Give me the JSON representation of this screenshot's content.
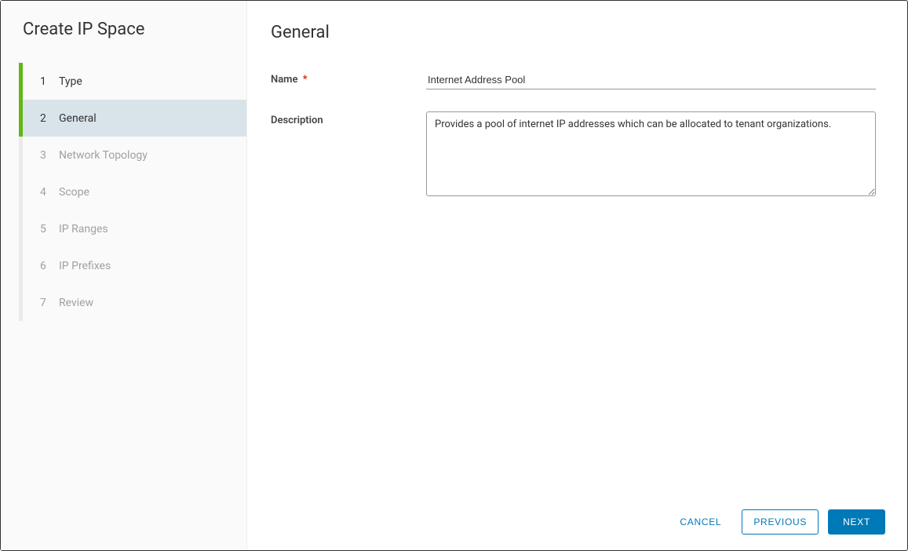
{
  "sidebar": {
    "title": "Create IP Space",
    "steps": [
      {
        "num": "1",
        "label": "Type",
        "state": "completed"
      },
      {
        "num": "2",
        "label": "General",
        "state": "active"
      },
      {
        "num": "3",
        "label": "Network Topology",
        "state": "pending"
      },
      {
        "num": "4",
        "label": "Scope",
        "state": "pending"
      },
      {
        "num": "5",
        "label": "IP Ranges",
        "state": "pending"
      },
      {
        "num": "6",
        "label": "IP Prefixes",
        "state": "pending"
      },
      {
        "num": "7",
        "label": "Review",
        "state": "pending"
      }
    ]
  },
  "main": {
    "title": "General",
    "name_label": "Name",
    "name_value": "Internet Address Pool",
    "description_label": "Description",
    "description_value": "Provides a pool of internet IP addresses which can be allocated to tenant organizations."
  },
  "footer": {
    "cancel": "CANCEL",
    "previous": "PREVIOUS",
    "next": "NEXT"
  }
}
